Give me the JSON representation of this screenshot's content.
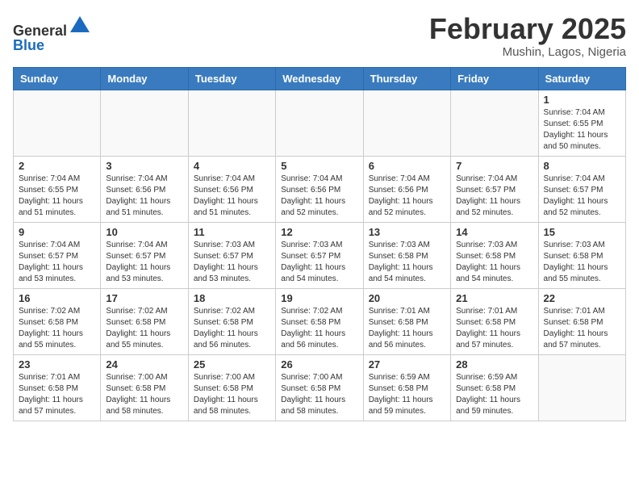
{
  "header": {
    "logo_line1": "General",
    "logo_line2": "Blue",
    "month": "February 2025",
    "location": "Mushin, Lagos, Nigeria"
  },
  "weekdays": [
    "Sunday",
    "Monday",
    "Tuesday",
    "Wednesday",
    "Thursday",
    "Friday",
    "Saturday"
  ],
  "weeks": [
    [
      {
        "day": "",
        "info": ""
      },
      {
        "day": "",
        "info": ""
      },
      {
        "day": "",
        "info": ""
      },
      {
        "day": "",
        "info": ""
      },
      {
        "day": "",
        "info": ""
      },
      {
        "day": "",
        "info": ""
      },
      {
        "day": "1",
        "info": "Sunrise: 7:04 AM\nSunset: 6:55 PM\nDaylight: 11 hours\nand 50 minutes."
      }
    ],
    [
      {
        "day": "2",
        "info": "Sunrise: 7:04 AM\nSunset: 6:55 PM\nDaylight: 11 hours\nand 51 minutes."
      },
      {
        "day": "3",
        "info": "Sunrise: 7:04 AM\nSunset: 6:56 PM\nDaylight: 11 hours\nand 51 minutes."
      },
      {
        "day": "4",
        "info": "Sunrise: 7:04 AM\nSunset: 6:56 PM\nDaylight: 11 hours\nand 51 minutes."
      },
      {
        "day": "5",
        "info": "Sunrise: 7:04 AM\nSunset: 6:56 PM\nDaylight: 11 hours\nand 52 minutes."
      },
      {
        "day": "6",
        "info": "Sunrise: 7:04 AM\nSunset: 6:56 PM\nDaylight: 11 hours\nand 52 minutes."
      },
      {
        "day": "7",
        "info": "Sunrise: 7:04 AM\nSunset: 6:57 PM\nDaylight: 11 hours\nand 52 minutes."
      },
      {
        "day": "8",
        "info": "Sunrise: 7:04 AM\nSunset: 6:57 PM\nDaylight: 11 hours\nand 52 minutes."
      }
    ],
    [
      {
        "day": "9",
        "info": "Sunrise: 7:04 AM\nSunset: 6:57 PM\nDaylight: 11 hours\nand 53 minutes."
      },
      {
        "day": "10",
        "info": "Sunrise: 7:04 AM\nSunset: 6:57 PM\nDaylight: 11 hours\nand 53 minutes."
      },
      {
        "day": "11",
        "info": "Sunrise: 7:03 AM\nSunset: 6:57 PM\nDaylight: 11 hours\nand 53 minutes."
      },
      {
        "day": "12",
        "info": "Sunrise: 7:03 AM\nSunset: 6:57 PM\nDaylight: 11 hours\nand 54 minutes."
      },
      {
        "day": "13",
        "info": "Sunrise: 7:03 AM\nSunset: 6:58 PM\nDaylight: 11 hours\nand 54 minutes."
      },
      {
        "day": "14",
        "info": "Sunrise: 7:03 AM\nSunset: 6:58 PM\nDaylight: 11 hours\nand 54 minutes."
      },
      {
        "day": "15",
        "info": "Sunrise: 7:03 AM\nSunset: 6:58 PM\nDaylight: 11 hours\nand 55 minutes."
      }
    ],
    [
      {
        "day": "16",
        "info": "Sunrise: 7:02 AM\nSunset: 6:58 PM\nDaylight: 11 hours\nand 55 minutes."
      },
      {
        "day": "17",
        "info": "Sunrise: 7:02 AM\nSunset: 6:58 PM\nDaylight: 11 hours\nand 55 minutes."
      },
      {
        "day": "18",
        "info": "Sunrise: 7:02 AM\nSunset: 6:58 PM\nDaylight: 11 hours\nand 56 minutes."
      },
      {
        "day": "19",
        "info": "Sunrise: 7:02 AM\nSunset: 6:58 PM\nDaylight: 11 hours\nand 56 minutes."
      },
      {
        "day": "20",
        "info": "Sunrise: 7:01 AM\nSunset: 6:58 PM\nDaylight: 11 hours\nand 56 minutes."
      },
      {
        "day": "21",
        "info": "Sunrise: 7:01 AM\nSunset: 6:58 PM\nDaylight: 11 hours\nand 57 minutes."
      },
      {
        "day": "22",
        "info": "Sunrise: 7:01 AM\nSunset: 6:58 PM\nDaylight: 11 hours\nand 57 minutes."
      }
    ],
    [
      {
        "day": "23",
        "info": "Sunrise: 7:01 AM\nSunset: 6:58 PM\nDaylight: 11 hours\nand 57 minutes."
      },
      {
        "day": "24",
        "info": "Sunrise: 7:00 AM\nSunset: 6:58 PM\nDaylight: 11 hours\nand 58 minutes."
      },
      {
        "day": "25",
        "info": "Sunrise: 7:00 AM\nSunset: 6:58 PM\nDaylight: 11 hours\nand 58 minutes."
      },
      {
        "day": "26",
        "info": "Sunrise: 7:00 AM\nSunset: 6:58 PM\nDaylight: 11 hours\nand 58 minutes."
      },
      {
        "day": "27",
        "info": "Sunrise: 6:59 AM\nSunset: 6:58 PM\nDaylight: 11 hours\nand 59 minutes."
      },
      {
        "day": "28",
        "info": "Sunrise: 6:59 AM\nSunset: 6:58 PM\nDaylight: 11 hours\nand 59 minutes."
      },
      {
        "day": "",
        "info": ""
      }
    ]
  ]
}
